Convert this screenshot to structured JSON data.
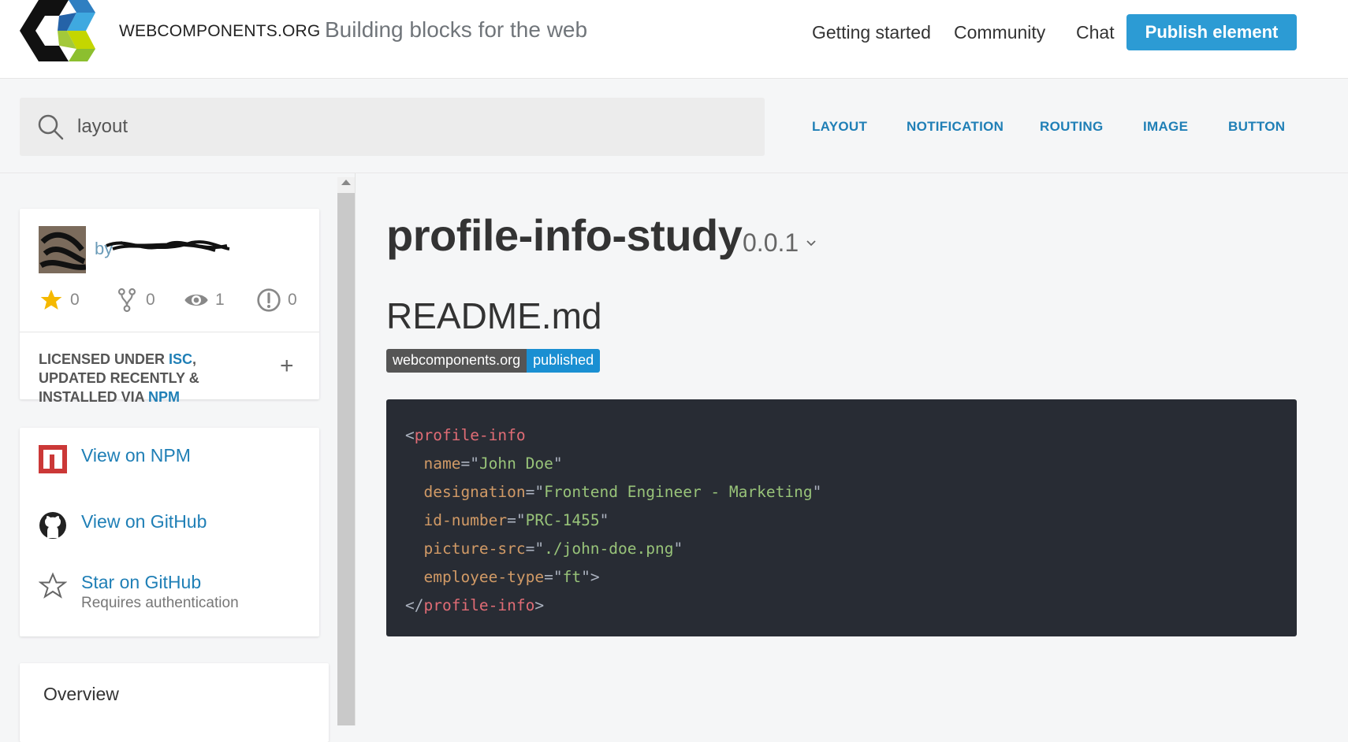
{
  "header": {
    "brand": "WEBCOMPONENTS.ORG",
    "tagline": "Building blocks for the web",
    "nav": [
      "Getting started",
      "Community",
      "Chat"
    ],
    "publish_label": "Publish element"
  },
  "search": {
    "value": "layout",
    "tags": [
      "LAYOUT",
      "NOTIFICATION",
      "ROUTING",
      "IMAGE",
      "BUTTON"
    ]
  },
  "author": {
    "by": "by",
    "stats": {
      "stars": "0",
      "forks": "0",
      "watchers": "1",
      "issues": "0"
    },
    "license": {
      "prefix": "Licensed under ",
      "license_name": "ISC",
      "middle": ", updated recently & installed via ",
      "installer": "NPM"
    }
  },
  "links": {
    "npm": "View on NPM",
    "github": "View on GitHub",
    "star": "Star on GitHub",
    "star_sub": "Requires authentication"
  },
  "overview": {
    "label": "Overview"
  },
  "element": {
    "title": "profile-info-study",
    "version": "0.0.1",
    "readme_title": "README.md",
    "badge_left": "webcomponents.org",
    "badge_right": "published"
  },
  "code": {
    "open_tag": "profile-info",
    "attrs": [
      {
        "name": "name",
        "value": "John Doe"
      },
      {
        "name": "designation",
        "value": "Frontend Engineer - Marketing"
      },
      {
        "name": "id-number",
        "value": "PRC-1455"
      },
      {
        "name": "picture-src",
        "value": "./john-doe.png"
      },
      {
        "name": "employee-type",
        "value": "ft"
      }
    ],
    "close_tag": "profile-info"
  },
  "colors": {
    "accent": "#2c9bd4",
    "link": "#1f7fb6",
    "code_bg": "#282c34"
  }
}
